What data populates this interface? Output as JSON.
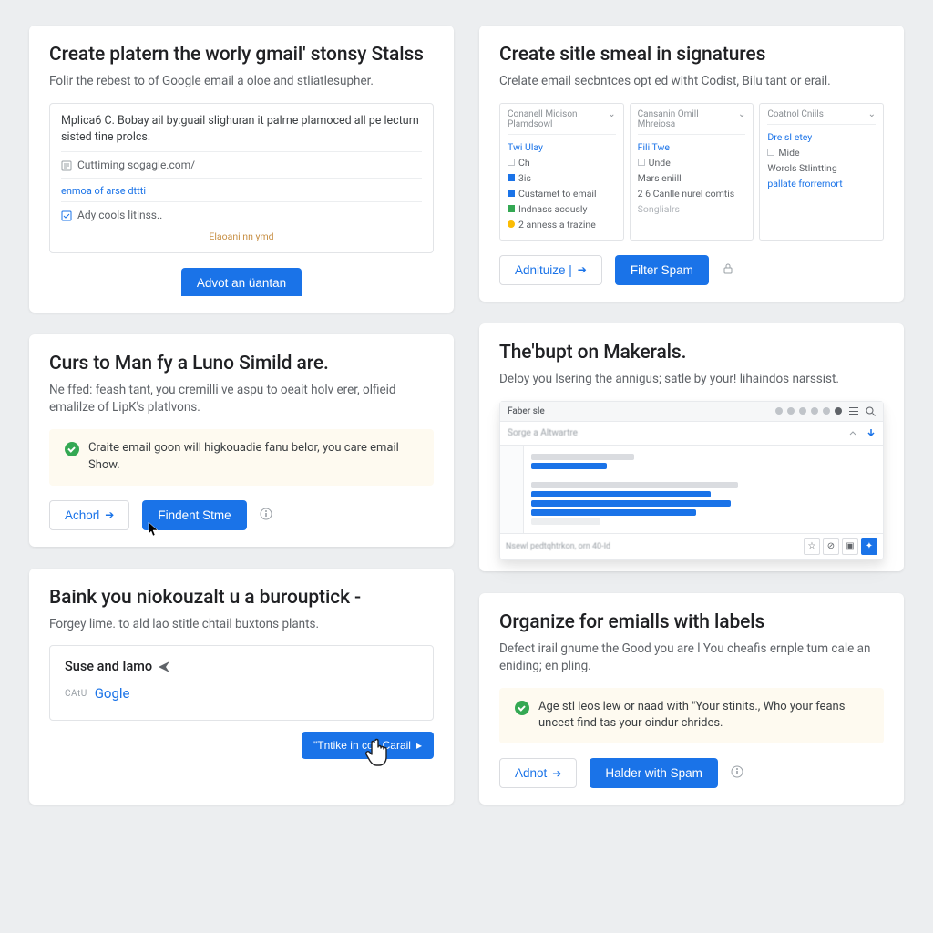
{
  "card1": {
    "title": "Create platern the worly gmail' stonsy Stalss",
    "desc": "Folir the rebest to of Google email a oloe and stliatlesupher.",
    "snippet_top": "Mplica6 C. Bobay ail by:guail slighuran it palrne plamoced all pe lecturn sisted tine prolcs.",
    "row1": "Cuttiming sogagle.com/",
    "row2_blur": "enmoa of arse dttti",
    "row3": "Ady cools litinss..",
    "footer_link": "Elaoani nn ymd",
    "button": "Advot an üantan"
  },
  "card2": {
    "title": "Curs to Man fy a Luno Simild are.",
    "desc": "Ne ffed: feash tant, you cremilli ve aspu to oeait holv erer, olfieid emalilze of LipK's platlvons.",
    "info": "Craite email goon will higkouadie fanu belor, you care email Show.",
    "btn_outline": "Achorl",
    "btn_primary": "Findent Stme"
  },
  "card3": {
    "title": "Baink you niokouzalt u a burouptick -",
    "desc": "Forgey lime. to ald lao stitle chtail buxtons plants.",
    "subject": "Suse and Iamo",
    "from_label": "CAtU",
    "from_value": "Gogle",
    "button": "\"Tntike in con Carail"
  },
  "card4": {
    "title": "Create sitle smeal in signatures",
    "desc": "Crelate email secbntces opt ed witht Codist, Bilu tant or erail.",
    "col1": {
      "hdr": "Conanell Micison Plamdsowl",
      "sub": "Twi Ulay",
      "l1": "Ch",
      "l2": "3is",
      "l3": "Custamet to email",
      "l4": "Indnass acously",
      "l5": "2 anness a trazine"
    },
    "col2": {
      "hdr": "Cansanin Omill Mhreiosa",
      "sub": "Fili Twe",
      "l1": "Unde",
      "l2": "Mars eniill",
      "l3": "2 6 Canlle nurel comtis",
      "l4": "Songlialrs"
    },
    "col3": {
      "hdr": "Coatnol Cniils",
      "sub": "Dre sI etey",
      "l1": "Mide",
      "l2": "Worcls Stlintting",
      "l3": "pallate frorrernort"
    },
    "btn_outline": "Adnituize |",
    "btn_primary": "Filter Spam"
  },
  "card5": {
    "title": "The'bupt on Makerals.",
    "desc": "Deloy you lsering the annigus; satle by your! lihaindos narssist.",
    "tab": "Faber sle",
    "search_blur": "Sorge a Altwartre",
    "footer_txt": "Nsewl pedtqhtrkon, orn 40-Id"
  },
  "card6": {
    "title": "Organize for emialls with labels",
    "desc": "Defect irail gnume the Good you are l You cheafis ernple tum cale an eniding; en pling.",
    "info": "Age stl leos lew or naad with \"Your stinits., Who your feans uncest find tas your oindur chrides.",
    "btn_outline": "Adnot",
    "btn_primary": "Halder with Spam"
  }
}
